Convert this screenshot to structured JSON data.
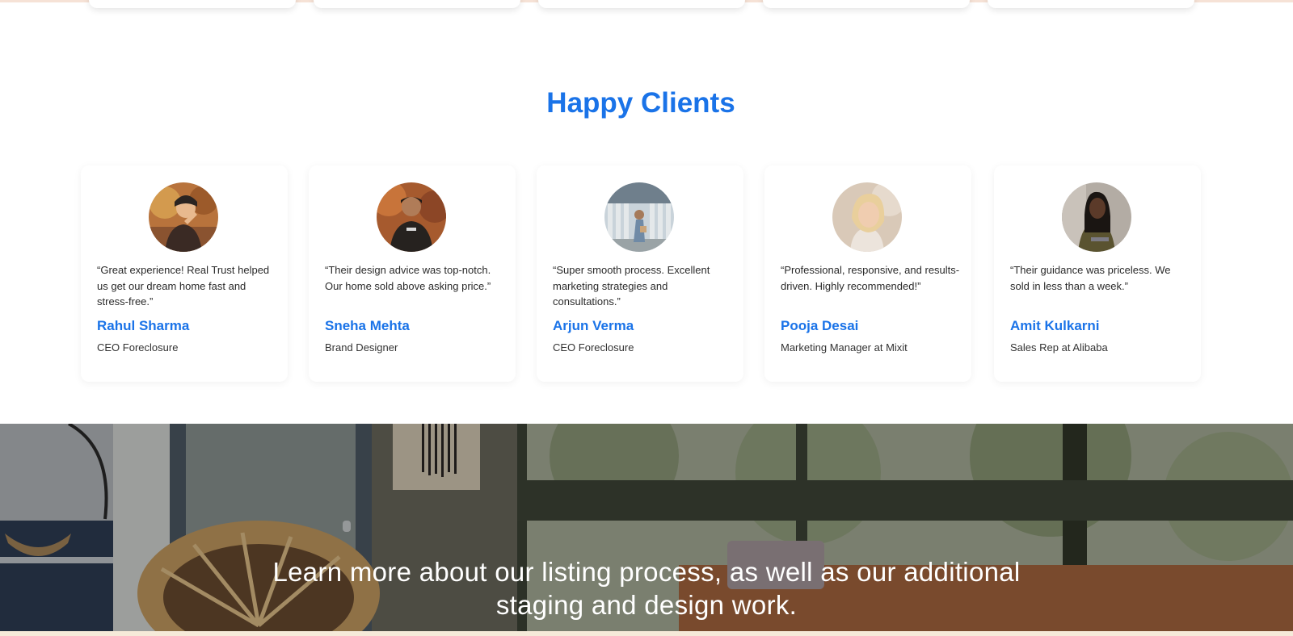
{
  "testimonials": {
    "title": "Happy Clients",
    "clients": [
      {
        "quote": "“Great experience! Real Trust helped us get our dream home fast and stress-free.”",
        "name": "Rahul Sharma",
        "role": "CEO Foreclosure",
        "avatar_icon": "person-photo-avatar"
      },
      {
        "quote": "“Their design advice was top-notch. Our home sold above asking price.”",
        "name": "Sneha Mehta",
        "role": "Brand Designer",
        "avatar_icon": "person-photo-avatar"
      },
      {
        "quote": "“Super smooth process. Excellent marketing strategies and consultations.”",
        "name": "Arjun Verma",
        "role": "CEO Foreclosure",
        "avatar_icon": "person-photo-avatar"
      },
      {
        "quote": "“Professional, responsive, and results-driven. Highly recommended!”",
        "name": "Pooja Desai",
        "role": "Marketing Manager at Mixit",
        "avatar_icon": "person-photo-avatar"
      },
      {
        "quote": "“Their guidance was priceless. We sold in less than a week.”",
        "name": "Amit Kulkarni",
        "role": "Sales Rep at Alibaba",
        "avatar_icon": "person-photo-avatar"
      }
    ]
  },
  "banner": {
    "text": "Learn more about our listing process, as well as our additional staging and design work."
  },
  "colors": {
    "accent": "#1a73e8",
    "banner_text": "#ffffff"
  }
}
